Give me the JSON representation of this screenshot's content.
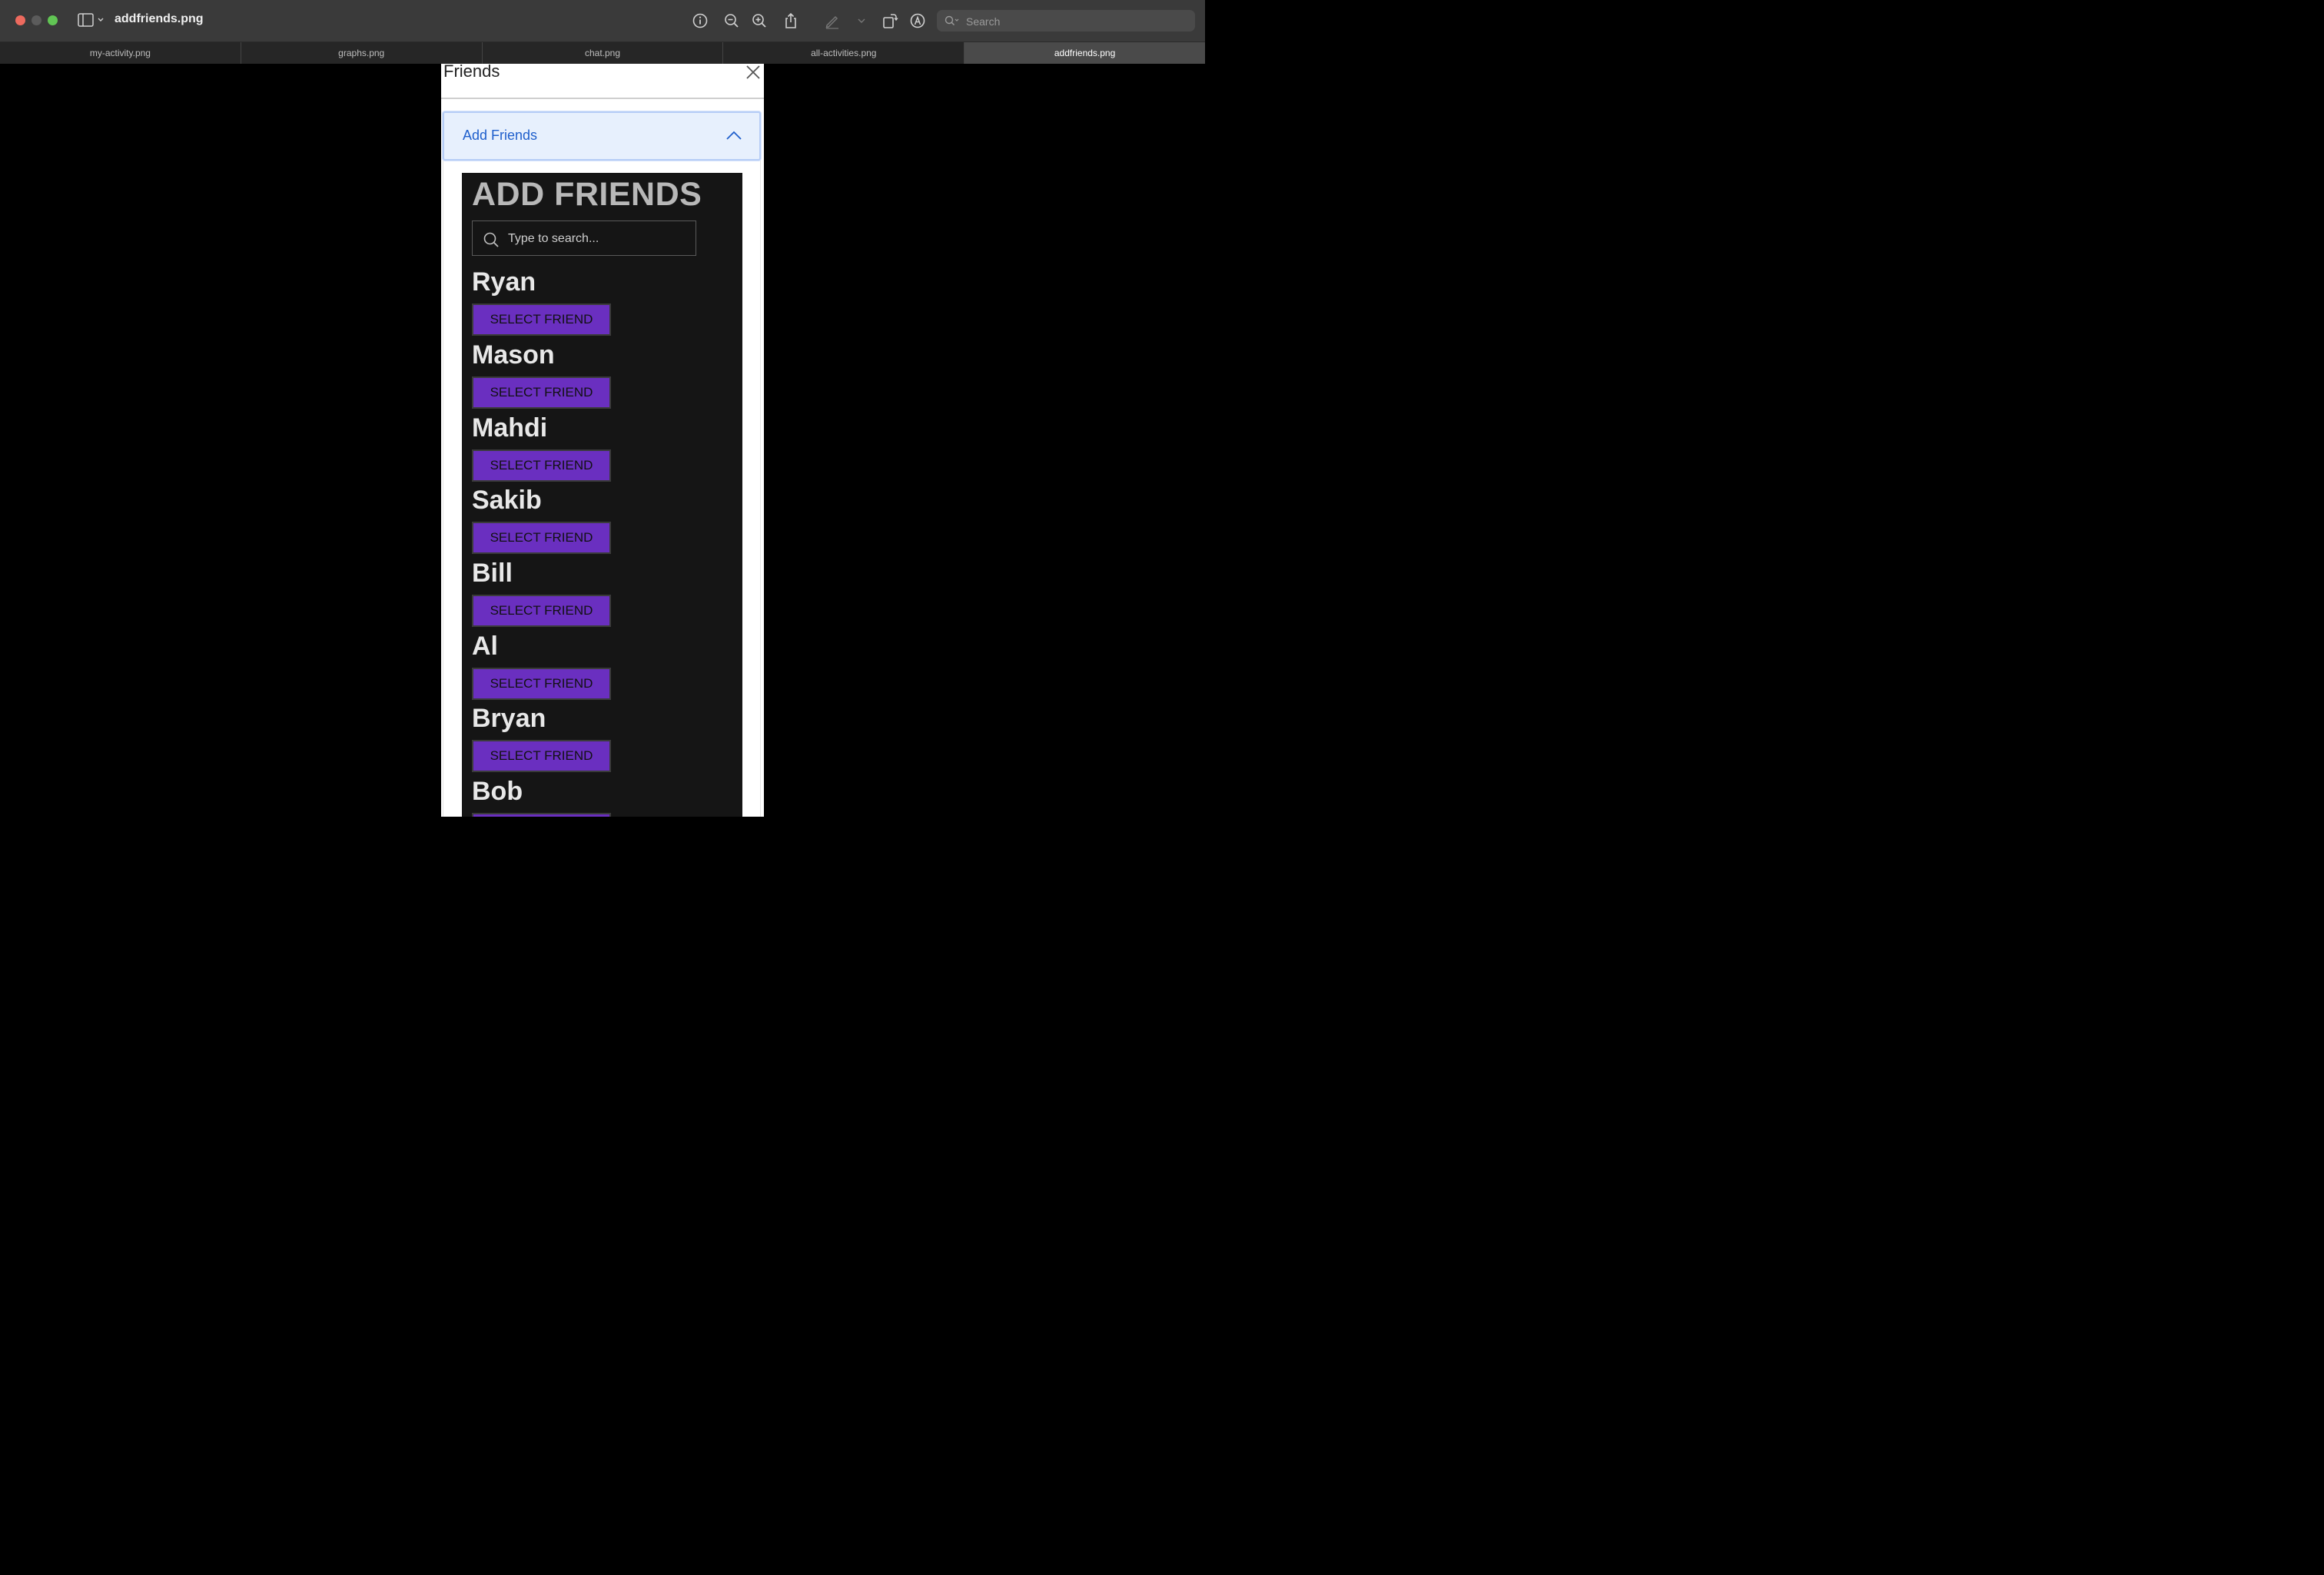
{
  "window": {
    "title": "addfriends.png",
    "search_placeholder": "Search"
  },
  "tabs": [
    {
      "label": "my-activity.png"
    },
    {
      "label": "graphs.png"
    },
    {
      "label": "chat.png"
    },
    {
      "label": "all-activities.png"
    },
    {
      "label": "addfriends.png",
      "active": true
    }
  ],
  "modal": {
    "title": "Friends",
    "accordion_label": "Add Friends",
    "section_title": "ADD FRIENDS",
    "search_placeholder": "Type to search...",
    "button_label": "SELECT FRIEND",
    "friends": [
      {
        "name": "Ryan"
      },
      {
        "name": "Mason"
      },
      {
        "name": "Mahdi"
      },
      {
        "name": "Sakib"
      },
      {
        "name": "Bill"
      },
      {
        "name": "Al"
      },
      {
        "name": "Bryan"
      },
      {
        "name": "Bob"
      }
    ]
  },
  "colors": {
    "accent_purple": "#6a2fc0",
    "accordion_bg": "#e7f0fd",
    "accordion_text": "#1f5fcc"
  }
}
